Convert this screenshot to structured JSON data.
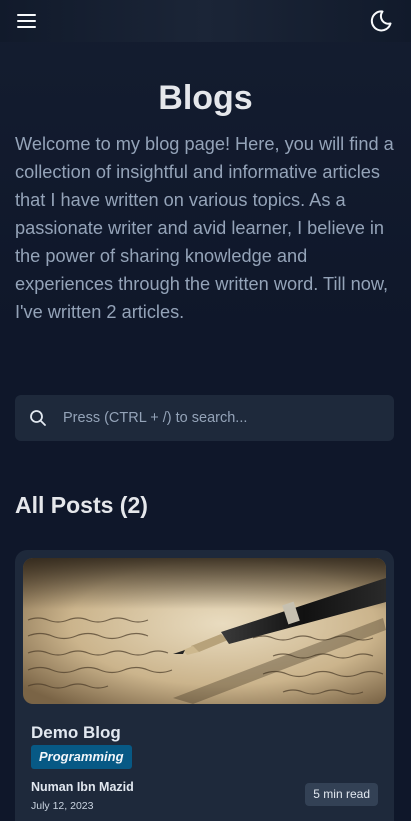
{
  "header": {
    "menu_icon": "hamburger-menu-icon",
    "theme_icon": "moon-icon"
  },
  "page": {
    "title": "Blogs",
    "intro": "Welcome to my blog page! Here, you will find a collection of insightful and informative articles that I have written on various topics. As a passionate writer and avid learner, I believe in the power of sharing knowledge and experiences through the written word. Till now, I've written 2 articles."
  },
  "search": {
    "placeholder": "Press (CTRL + /) to search...",
    "value": "",
    "icon": "search-icon"
  },
  "posts_section": {
    "title": "All Posts (2)"
  },
  "posts": [
    {
      "title": "Demo Blog",
      "tag": "Programming",
      "author": "Numan Ibn Mazid",
      "date": "July 12, 2023",
      "read_time": "5 min read",
      "image": "fountain-pen-writing-image"
    }
  ],
  "colors": {
    "background": "#0f172a",
    "card": "#1e293b",
    "tag": "#075985",
    "badge": "#334155",
    "muted_text": "#94a3b8"
  }
}
